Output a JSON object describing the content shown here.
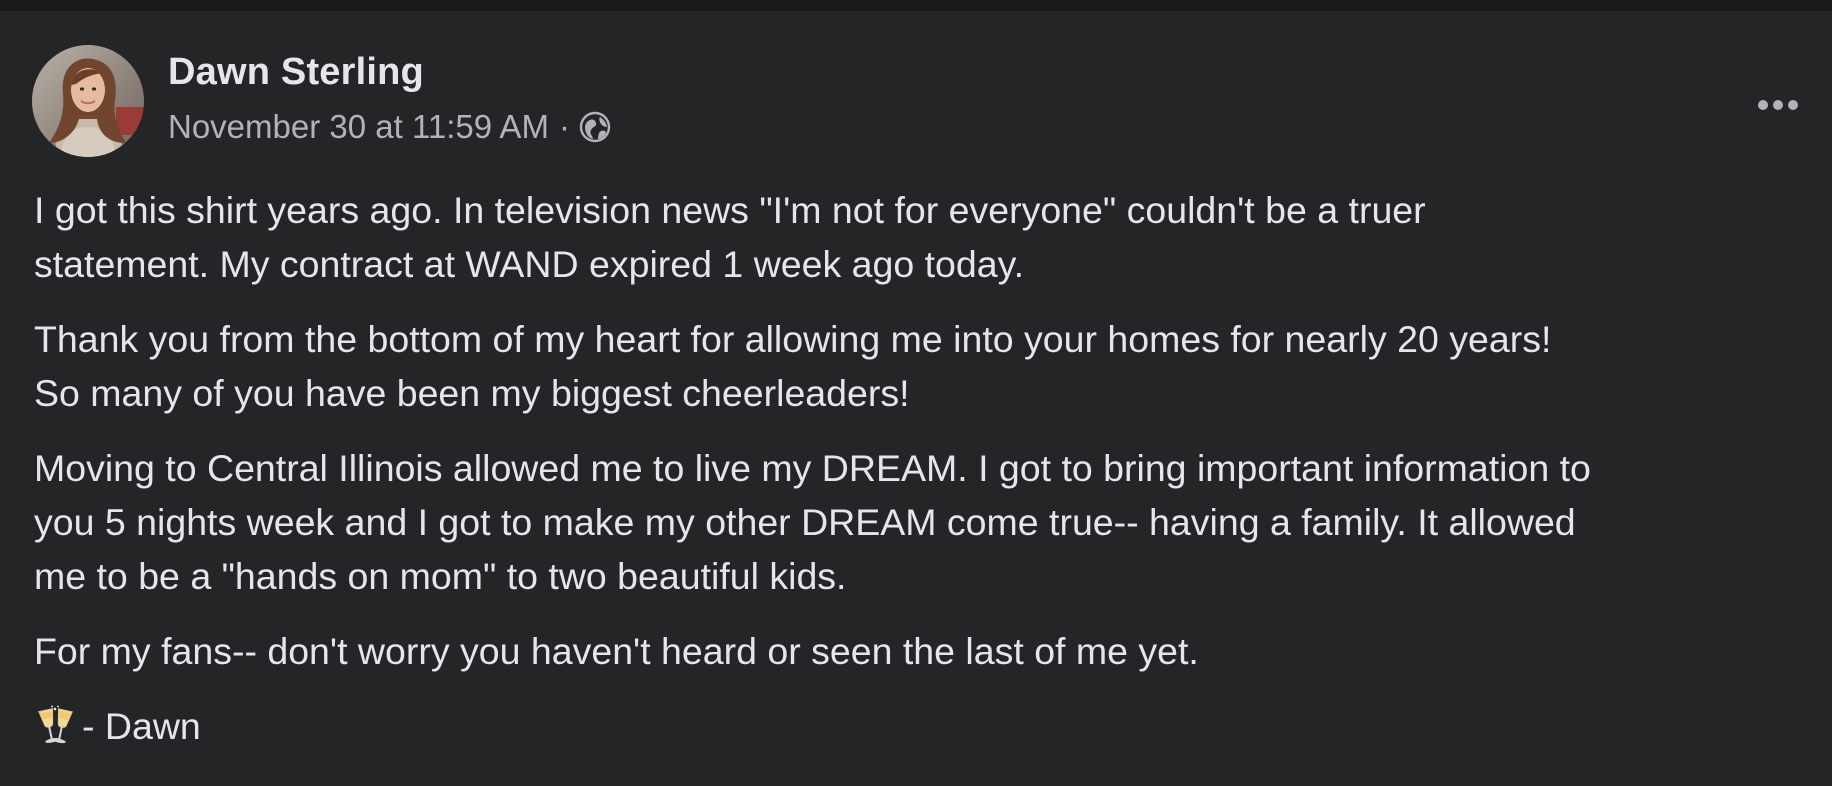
{
  "post": {
    "author": "Dawn Sterling",
    "timestamp": "November 30 at 11:59 AM",
    "separator": "·",
    "privacy_icon": "globe-icon",
    "more_icon": "more-horizontal-icon",
    "paragraphs": [
      {
        "lines": [
          "I got this shirt years ago. In television news \"I'm not for everyone\" couldn't be a truer",
          "statement. My contract at WAND expired 1 week ago today."
        ]
      },
      {
        "lines": [
          "Thank you from the bottom of my heart for allowing me into your homes for nearly 20 years!",
          "So many of you have been my biggest cheerleaders!"
        ]
      },
      {
        "lines": [
          "Moving to Central Illinois allowed me to live my DREAM. I got to bring important information to",
          "you 5 nights week and I got to make my other DREAM come true-- having a family. It allowed",
          "me to be a \"hands on mom\" to two beautiful kids."
        ]
      },
      {
        "lines": [
          "For my fans-- don't worry you haven't heard or seen the last of me yet."
        ]
      }
    ],
    "signoff_icon": "clinking-glasses-icon",
    "signoff_text": "- Dawn"
  },
  "colors": {
    "background": "#242526",
    "top_strip": "#18191a",
    "primary_text": "#e4e6eb",
    "secondary_text": "#b0b3b8"
  }
}
